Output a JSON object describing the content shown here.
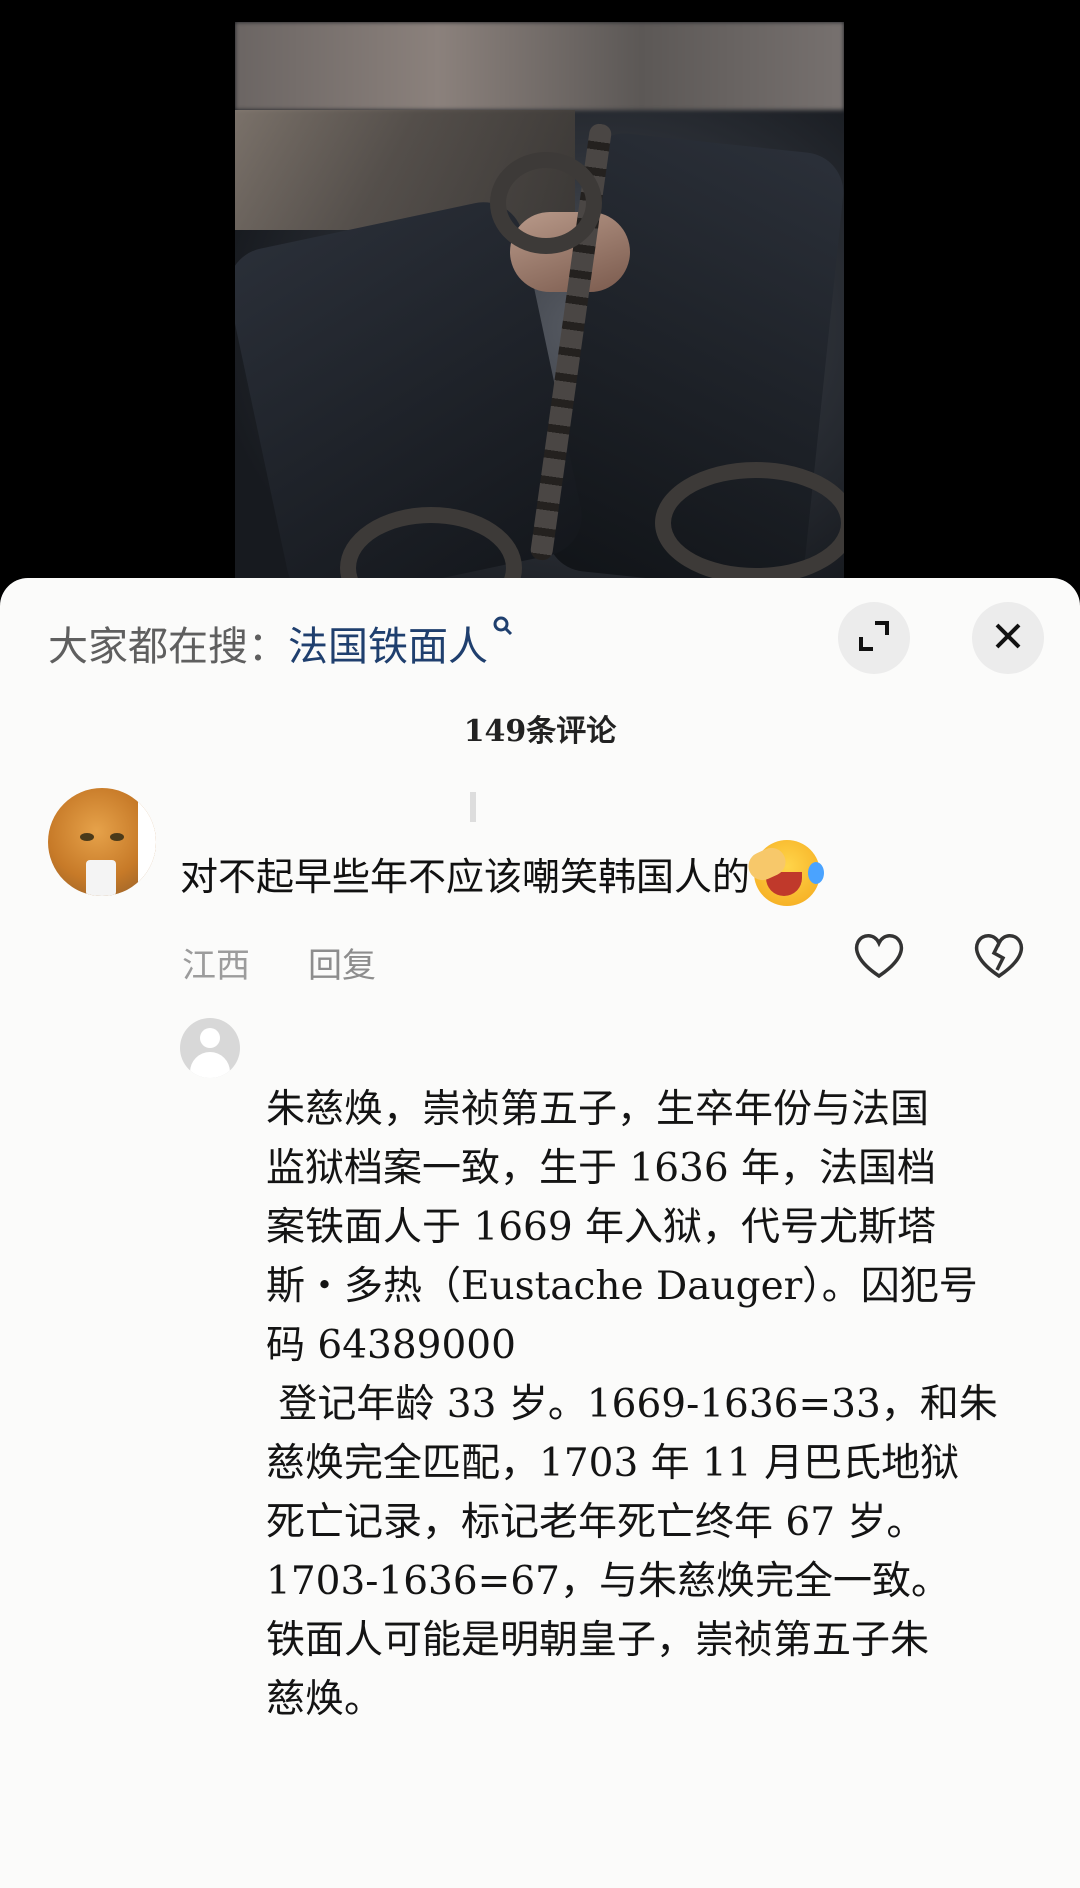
{
  "search": {
    "prefix": "大家都在搜：",
    "term": "法国铁面人"
  },
  "comments_count": "149条评论",
  "comment": {
    "text": "对不起早些年不应该嘲笑韩国人的",
    "emoji": "laughing-crying-face",
    "location": "江西",
    "reply_label": "回复"
  },
  "reply": {
    "lines": [
      "朱慈焕，崇祯第五子，生卒年份与法国",
      "监狱档案一致，生于 1636 年，法国档",
      "案铁面人于 1669 年入狱，代号尤斯塔",
      "斯・多热（Eustache Dauger）。囚犯号",
      "码 64389000",
      " 登记年龄 33 岁。1669-1636=33，和朱",
      "慈焕完全匹配，1703 年 11 月巴氏地狱",
      "死亡记录，标记老年死亡终年 67 岁。",
      "1703-1636=67，与朱慈焕完全一致。",
      "铁面人可能是明朝皇子，崇祯第五子朱",
      "慈焕。"
    ]
  },
  "colors": {
    "sheet_bg": "#fbfbfa",
    "link": "#1f3f6e",
    "muted": "#9c9c9c"
  }
}
